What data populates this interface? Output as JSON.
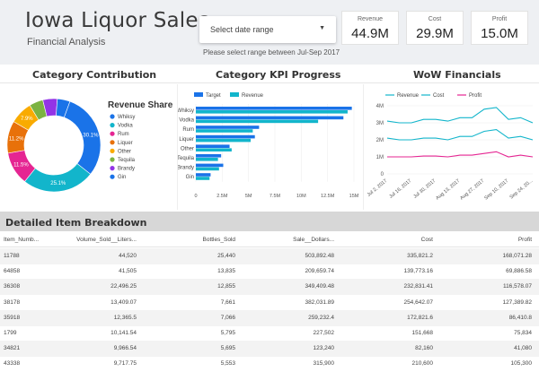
{
  "header": {
    "title": "Iowa Liquor Sales",
    "subtitle": "Financial Analysis",
    "date_placeholder": "Select date range",
    "date_caret": "▼",
    "hint": "Please select range between Jul-Sep 2017"
  },
  "kpis": [
    {
      "label": "Revenue",
      "value": "44.9M"
    },
    {
      "label": "Cost",
      "value": "29.9M"
    },
    {
      "label": "Profit",
      "value": "15.0M"
    }
  ],
  "sections": {
    "category_contribution": "Category Contribution",
    "category_kpi": "Category KPI Progress",
    "wow": "WoW Financials"
  },
  "colors": {
    "blue": "#1a73e8",
    "teal": "#12b5cb",
    "pink": "#e52592",
    "orange": "#e8710a",
    "yellow": "#f9ab00",
    "green": "#7cb342",
    "purple": "#9334e6",
    "darkblue": "#1967d2",
    "target": "#1a73e8",
    "revenue": "#12b5cb",
    "cost": "#12b5cb",
    "profit": "#e52592"
  },
  "chart_data": [
    {
      "type": "pie",
      "title": "Revenue Share",
      "categories": [
        "Whiksy",
        "Vodka",
        "Rum",
        "Liquer",
        "Other",
        "Tequila",
        "Brandy",
        "Gin"
      ],
      "values": [
        30.1,
        25.1,
        11.5,
        11.2,
        7.9,
        4.8,
        5.0,
        4.4
      ],
      "labels": [
        "30.1%",
        "25.1%",
        "11.5%",
        "11.2%",
        "7.9%",
        "",
        "",
        ""
      ],
      "colors": [
        "#1a73e8",
        "#12b5cb",
        "#e52592",
        "#e8710a",
        "#f9ab00",
        "#7cb342",
        "#9334e6",
        "#1a73e8"
      ]
    },
    {
      "type": "bar",
      "orientation": "horizontal",
      "categories": [
        "Whiksy",
        "Vodka",
        "Rum",
        "Liquer",
        "Other",
        "Tequila",
        "Brandy",
        "Gin"
      ],
      "series": [
        {
          "name": "Target",
          "values": [
            14.8,
            14.0,
            6.0,
            5.6,
            3.2,
            2.4,
            2.6,
            1.4
          ]
        },
        {
          "name": "Revenue",
          "values": [
            14.4,
            11.6,
            5.4,
            5.2,
            3.4,
            2.1,
            2.2,
            1.3
          ]
        }
      ],
      "xlim": [
        0,
        15
      ],
      "xticks": [
        "0",
        "2.5M",
        "5M",
        "7.5M",
        "10M",
        "12.5M",
        "15M"
      ],
      "legend": "top-left"
    },
    {
      "type": "line",
      "x": [
        "Jul 2, 2017",
        "Jul 9, 2017",
        "Jul 16, 2017",
        "Jul 23, 2017",
        "Jul 30, 2017",
        "Aug 6, 2017",
        "Aug 13, 2017",
        "Aug 20, 2017",
        "Aug 27, 2017",
        "Sep 3, 2017",
        "Sep 10, 2017",
        "Sep 17, 2017",
        "Sep 24, 2017"
      ],
      "xticks": [
        "Jul 2, 2017",
        "Jul 16, 2017",
        "Jul 30, 2017",
        "Aug 13, 2017",
        "Aug 27, 2017",
        "Sep 10, 2017",
        "Sep 24, 20..."
      ],
      "series": [
        {
          "name": "Revenue",
          "values": [
            3.1,
            3.0,
            3.0,
            3.2,
            3.2,
            3.1,
            3.3,
            3.3,
            3.8,
            3.9,
            3.2,
            3.3,
            3.0
          ]
        },
        {
          "name": "Cost",
          "values": [
            2.1,
            2.0,
            2.0,
            2.1,
            2.1,
            2.0,
            2.2,
            2.2,
            2.5,
            2.6,
            2.1,
            2.2,
            2.0
          ]
        },
        {
          "name": "Profit",
          "values": [
            1.0,
            1.0,
            1.0,
            1.05,
            1.05,
            1.0,
            1.1,
            1.1,
            1.2,
            1.3,
            1.0,
            1.1,
            1.0
          ]
        }
      ],
      "ylim": [
        0,
        4
      ],
      "yticks": [
        "0",
        "1M",
        "2M",
        "3M",
        "4M"
      ],
      "legend": "top"
    }
  ],
  "table": {
    "title": "Detailed Item Breakdown",
    "columns": [
      "Item_Numb...",
      "Volume_Sold__Liters...",
      "Bottles_Sold",
      "Sale__Dollars...",
      "Cost",
      "Profit"
    ],
    "rows": [
      [
        "11788",
        "44,520",
        "25,440",
        "503,892.48",
        "335,821.2",
        "168,071.28"
      ],
      [
        "64858",
        "41,505",
        "13,835",
        "209,659.74",
        "139,773.16",
        "69,886.58"
      ],
      [
        "36308",
        "22,496.25",
        "12,855",
        "349,409.48",
        "232,831.41",
        "116,578.07"
      ],
      [
        "38178",
        "13,409.07",
        "7,661",
        "382,031.89",
        "254,642.07",
        "127,389.82"
      ],
      [
        "35918",
        "12,365.5",
        "7,066",
        "259,232.4",
        "172,821.6",
        "86,410.8"
      ],
      [
        "1799",
        "10,141.54",
        "5,795",
        "227,502",
        "151,668",
        "75,834"
      ],
      [
        "34821",
        "9,966.54",
        "5,695",
        "123,240",
        "82,160",
        "41,080"
      ],
      [
        "43338",
        "9,717.75",
        "5,553",
        "315,900",
        "210,600",
        "105,300"
      ]
    ]
  }
}
